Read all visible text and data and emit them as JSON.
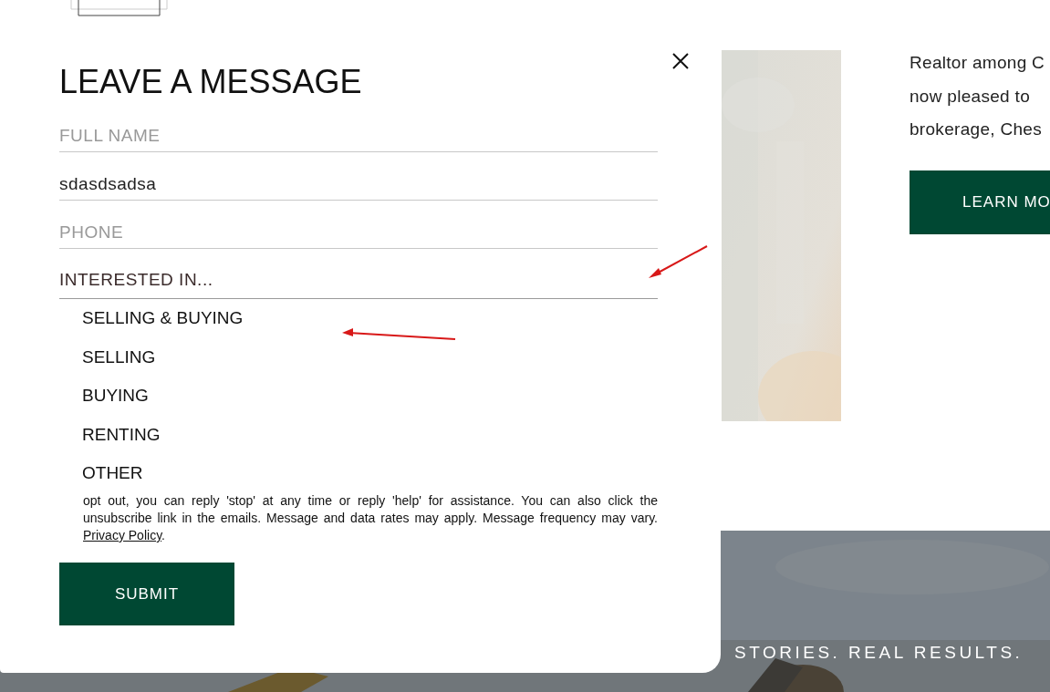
{
  "page": {
    "intro_lines": [
      "Realtor among C",
      "now pleased to",
      "brokerage, Ches"
    ],
    "learn_more_button": "LEARN MO",
    "banner_tagline": "STORIES. REAL RESULTS."
  },
  "modal": {
    "title": "LEAVE A MESSAGE",
    "fields": [
      {
        "kind": "text",
        "placeholder": "FULL NAME"
      },
      {
        "kind": "text",
        "value": "sdasdsadsa"
      },
      {
        "kind": "text",
        "placeholder": "PHONE"
      },
      {
        "kind": "select",
        "value": "INTERESTED IN...",
        "expanded": true
      }
    ],
    "options": [
      "SELLING & BUYING",
      "SELLING",
      "BUYING",
      "RENTING",
      "OTHER"
    ],
    "disclaimer": "opt out, you can reply 'stop' at any time or reply 'help' for assistance. You can also click the unsubscribe link in the emails. Message and data rates may apply. Message frequency may vary.",
    "privacy_link": "Privacy Policy",
    "privacy_suffix": ".",
    "submit_button": "SUBMIT"
  }
}
